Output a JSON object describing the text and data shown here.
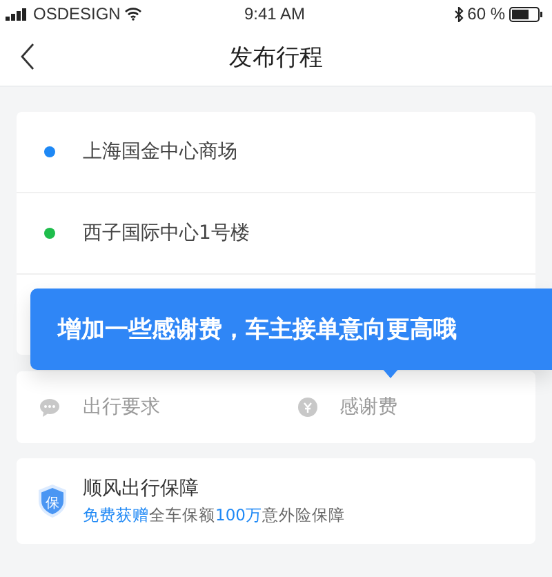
{
  "status_bar": {
    "carrier": "OSDESIGN",
    "time": "9:41 AM",
    "battery": "60 %"
  },
  "nav": {
    "title": "发布行程"
  },
  "route": [
    {
      "name": "上海国金中心商场",
      "color": "#1e88f5"
    },
    {
      "name": "西子国际中心1号楼",
      "color": "#1fbd4c"
    }
  ],
  "tooltip": {
    "text": "增加一些感谢费，车主接单意向更高哦"
  },
  "options": [
    {
      "kind": "chat",
      "placeholder": "出行要求"
    },
    {
      "kind": "coin",
      "placeholder": "感谢费"
    }
  ],
  "guarantee": {
    "badge": "保",
    "title": "顺风出行保障",
    "parts": [
      {
        "text": "免费获赠",
        "highlight": true
      },
      {
        "text": "全车保额",
        "highlight": false
      },
      {
        "text": "100万",
        "highlight": true
      },
      {
        "text": "意外险保障",
        "highlight": false
      }
    ]
  }
}
